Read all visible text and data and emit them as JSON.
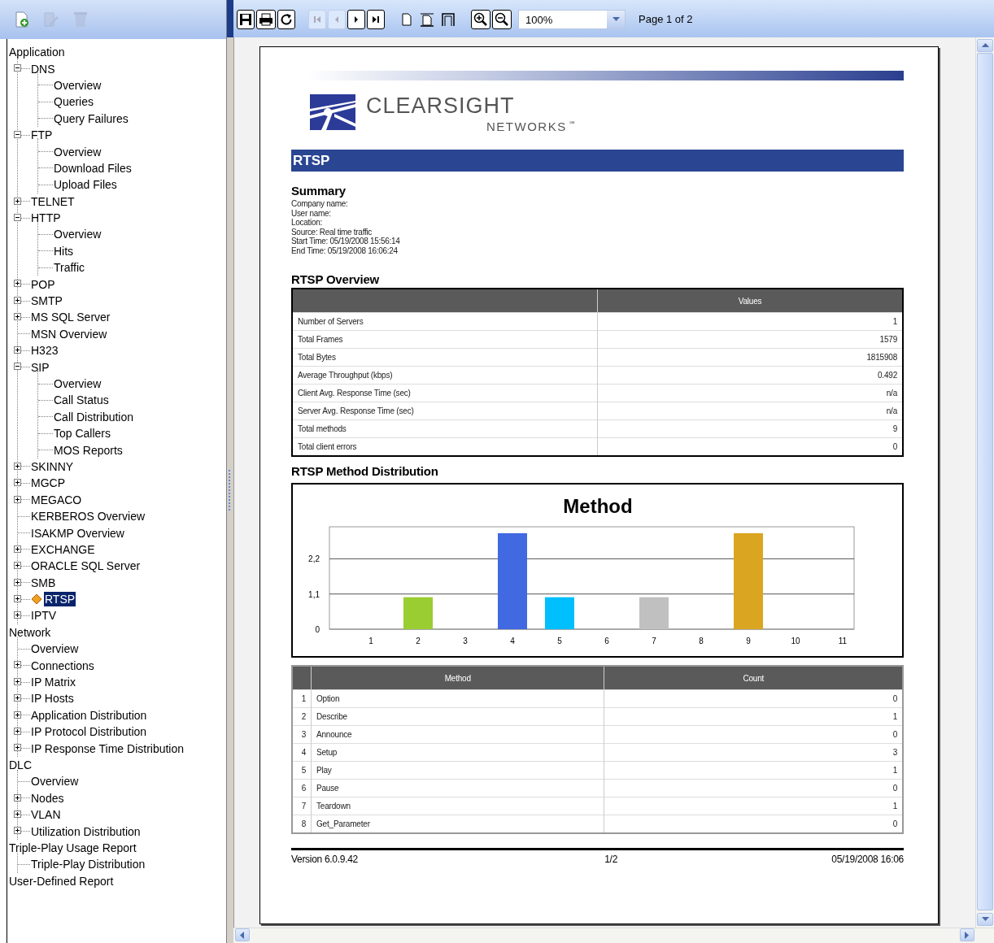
{
  "left_toolbar": {
    "buttons": [
      {
        "kind": "new-report",
        "disabled": false
      },
      {
        "kind": "edit",
        "disabled": true
      },
      {
        "kind": "delete",
        "disabled": true
      }
    ]
  },
  "tree": {
    "items": [
      {
        "label": "Application",
        "selected": false,
        "children": [
          {
            "label": "DNS",
            "expanded": true,
            "selected": false,
            "children": [
              {
                "label": "Overview",
                "selected": false
              },
              {
                "label": "Queries",
                "selected": false
              },
              {
                "label": "Query Failures",
                "selected": false
              }
            ]
          },
          {
            "label": "FTP",
            "expanded": true,
            "selected": false,
            "children": [
              {
                "label": "Overview",
                "selected": false
              },
              {
                "label": "Download Files",
                "selected": false
              },
              {
                "label": "Upload Files",
                "selected": false
              }
            ]
          },
          {
            "label": "TELNET",
            "expanded": false,
            "selected": false
          },
          {
            "label": "HTTP",
            "expanded": true,
            "selected": false,
            "children": [
              {
                "label": "Overview",
                "selected": false
              },
              {
                "label": "Hits",
                "selected": false
              },
              {
                "label": "Traffic",
                "selected": false
              }
            ]
          },
          {
            "label": "POP",
            "expanded": false,
            "selected": false
          },
          {
            "label": "SMTP",
            "expanded": false,
            "selected": false
          },
          {
            "label": "MS SQL Server",
            "expanded": false,
            "selected": false
          },
          {
            "label": "MSN Overview",
            "selected": false
          },
          {
            "label": "H323",
            "expanded": false,
            "selected": false
          },
          {
            "label": "SIP",
            "expanded": true,
            "selected": false,
            "children": [
              {
                "label": "Overview",
                "selected": false
              },
              {
                "label": "Call Status",
                "selected": false
              },
              {
                "label": "Call Distribution",
                "selected": false
              },
              {
                "label": "Top Callers",
                "selected": false
              },
              {
                "label": "MOS Reports",
                "selected": false
              }
            ]
          },
          {
            "label": "SKINNY",
            "expanded": false,
            "selected": false
          },
          {
            "label": "MGCP",
            "expanded": false,
            "selected": false
          },
          {
            "label": "MEGACO",
            "expanded": false,
            "selected": false
          },
          {
            "label": "KERBEROS Overview",
            "selected": false
          },
          {
            "label": "ISAKMP Overview",
            "selected": false
          },
          {
            "label": "EXCHANGE",
            "expanded": false,
            "selected": false
          },
          {
            "label": "ORACLE SQL Server",
            "expanded": false,
            "selected": false
          },
          {
            "label": "SMB",
            "expanded": false,
            "selected": false
          },
          {
            "label": "RTSP",
            "expanded": false,
            "selected": true
          },
          {
            "label": "IPTV",
            "expanded": false,
            "selected": false
          }
        ]
      },
      {
        "label": "Network",
        "selected": false,
        "children": [
          {
            "label": "Overview",
            "selected": false
          },
          {
            "label": "Connections",
            "expanded": false,
            "selected": false
          },
          {
            "label": "IP Matrix",
            "expanded": false,
            "selected": false
          },
          {
            "label": "IP Hosts",
            "expanded": false,
            "selected": false
          },
          {
            "label": "Application Distribution",
            "expanded": false,
            "selected": false
          },
          {
            "label": "IP Protocol Distribution",
            "expanded": false,
            "selected": false
          },
          {
            "label": "IP Response Time Distribution",
            "expanded": false,
            "selected": false
          }
        ]
      },
      {
        "label": "DLC",
        "selected": false,
        "children": [
          {
            "label": "Overview",
            "selected": false
          },
          {
            "label": "Nodes",
            "expanded": false,
            "selected": false
          },
          {
            "label": "VLAN",
            "expanded": false,
            "selected": false
          },
          {
            "label": "Utilization Distribution",
            "expanded": false,
            "selected": false
          }
        ]
      },
      {
        "label": "Triple-Play Usage Report",
        "selected": false,
        "children": [
          {
            "label": "Triple-Play Distribution",
            "selected": false
          }
        ]
      },
      {
        "label": "User-Defined Report",
        "selected": false
      }
    ]
  },
  "viewer_toolbar": {
    "buttons": [
      {
        "kind": "save",
        "disabled": false
      },
      {
        "kind": "print",
        "disabled": false
      },
      {
        "kind": "refresh",
        "disabled": false
      },
      {
        "kind": "first",
        "disabled": true
      },
      {
        "kind": "previous",
        "disabled": true
      },
      {
        "kind": "next",
        "disabled": false
      },
      {
        "kind": "last",
        "disabled": false
      },
      {
        "kind": "single-page",
        "disabled": false
      },
      {
        "kind": "page-width",
        "disabled": false
      },
      {
        "kind": "whole-page",
        "disabled": false
      },
      {
        "kind": "zoom-in",
        "disabled": false
      },
      {
        "kind": "zoom-out",
        "disabled": false
      }
    ],
    "zoom": {
      "value": "100%"
    },
    "page_indicator": "Page 1 of 2"
  },
  "report": {
    "brand": {
      "name": "CLEARSIGHT",
      "subtitle": "NETWORKS",
      "mark": "℠"
    },
    "section_title": "RTSP",
    "summary": {
      "heading": "Summary",
      "lines": [
        "Company name:",
        "User name:",
        "Location:",
        "Source: Real time traffic",
        "Start Time: 05/19/2008 15:56:14",
        "End Time: 05/19/2008 16:06:24"
      ]
    },
    "overview": {
      "heading": "RTSP Overview",
      "value_column": "Values",
      "rows": [
        {
          "label": "Number of Servers",
          "value": "1"
        },
        {
          "label": "Total Frames",
          "value": "1579"
        },
        {
          "label": "Total Bytes",
          "value": "1815908"
        },
        {
          "label": "Average Throughput (kbps)",
          "value": "0.492"
        },
        {
          "label": "Client Avg. Response Time (sec)",
          "value": "n/a"
        },
        {
          "label": "Server Avg. Response Time (sec)",
          "value": "n/a"
        },
        {
          "label": "Total methods",
          "value": "9"
        },
        {
          "label": "Total client errors",
          "value": "0"
        }
      ]
    },
    "distribution": {
      "heading": "RTSP Method Distribution",
      "chart_data": {
        "type": "bar",
        "title": "Method",
        "categories": [
          "1",
          "2",
          "3",
          "4",
          "5",
          "6",
          "7",
          "8",
          "9",
          "10",
          "11"
        ],
        "values": [
          0,
          1,
          0,
          3,
          1,
          0,
          1,
          0,
          3,
          0,
          0
        ],
        "ylim": [
          0,
          3.2
        ],
        "yticks": [
          0,
          {
            "value": 1.1,
            "label": "1,1"
          },
          {
            "value": 2.2,
            "label": "2,2"
          }
        ]
      },
      "table": {
        "columns": [
          "Method",
          "Count"
        ],
        "rows": [
          {
            "index": "1",
            "method": "Option",
            "count": "0"
          },
          {
            "index": "2",
            "method": "Describe",
            "count": "1"
          },
          {
            "index": "3",
            "method": "Announce",
            "count": "0"
          },
          {
            "index": "4",
            "method": "Setup",
            "count": "3"
          },
          {
            "index": "5",
            "method": "Play",
            "count": "1"
          },
          {
            "index": "6",
            "method": "Pause",
            "count": "0"
          },
          {
            "index": "7",
            "method": "Teardown",
            "count": "1"
          },
          {
            "index": "8",
            "method": "Get_Parameter",
            "count": "0"
          }
        ]
      }
    },
    "footer": {
      "version": "Version 6.0.9.42",
      "page": "1/2",
      "date": "05/19/2008 16:06"
    }
  }
}
